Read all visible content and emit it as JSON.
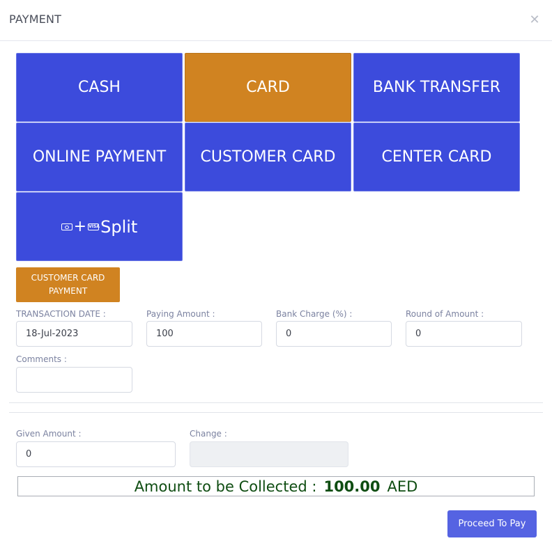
{
  "modal": {
    "title": "PAYMENT",
    "close_icon": "close-icon"
  },
  "payment_methods": [
    {
      "label": "CASH",
      "active": false
    },
    {
      "label": "CARD",
      "active": true
    },
    {
      "label": "BANK TRANSFER",
      "active": false
    },
    {
      "label": "ONLINE PAYMENT",
      "active": false
    },
    {
      "label": "CUSTOMER CARD",
      "active": false
    },
    {
      "label": "CENTER CARD",
      "active": false
    },
    {
      "label": "Split",
      "icons": [
        "cash-icon",
        "plus",
        "visa-card-icon"
      ],
      "active": false
    }
  ],
  "customer_card_payment": {
    "label": "CUSTOMER CARD PAYMENT"
  },
  "form": {
    "transaction_date": {
      "label": "TRANSACTION DATE :",
      "value": "18-Jul-2023"
    },
    "paying_amount": {
      "label": "Paying Amount :",
      "value": "100"
    },
    "bank_charge": {
      "label": "Bank Charge (%) :",
      "value": "0"
    },
    "round_of_amount": {
      "label": "Round of Amount :",
      "value": "0"
    },
    "comments": {
      "label": "Comments :",
      "value": ""
    }
  },
  "change_section": {
    "given_amount": {
      "label": "Given Amount :",
      "value": "0"
    },
    "change": {
      "label": "Change :",
      "value": ""
    }
  },
  "summary": {
    "label": "Amount to be Collected :",
    "amount": "100.00",
    "currency": "AED"
  },
  "actions": {
    "proceed_label": "Proceed To Pay"
  },
  "colors": {
    "method_blue": "#3c4bdc",
    "active_orange": "#d08321",
    "collect_green": "#0f4d12",
    "proceed_blue": "#5563e2"
  }
}
